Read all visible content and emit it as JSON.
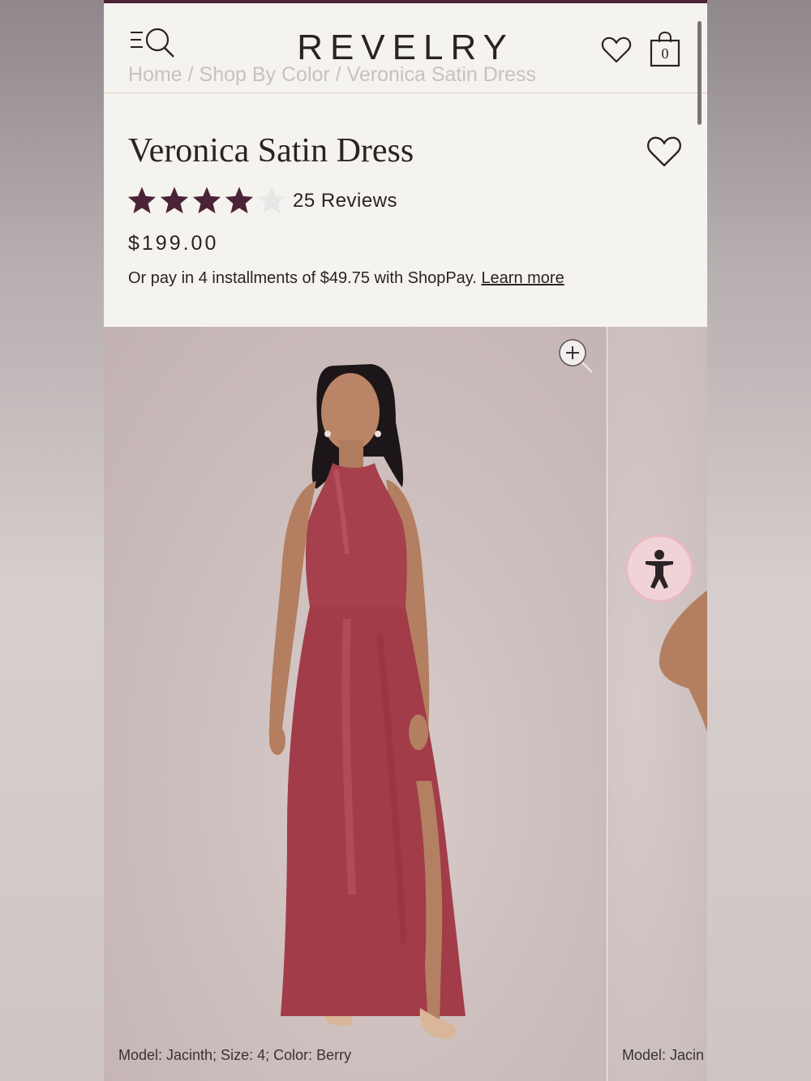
{
  "header": {
    "logo": "REVELRY",
    "menu_icon": "menu-search-icon",
    "wishlist_icon": "heart-icon",
    "bag_icon": "shopping-bag-icon",
    "bag_count": "0"
  },
  "breadcrumb": {
    "items": [
      "Home",
      "Shop By Color",
      "Veronica Satin Dress"
    ],
    "separator": " / "
  },
  "product": {
    "title": "Veronica Satin Dress",
    "rating_stars": 4,
    "rating_max": 5,
    "reviews_label": "25 Reviews",
    "price": "$199.00",
    "installments_text": "Or pay in 4 installments of $49.75 with ShopPay.",
    "learn_more_label": "Learn more"
  },
  "gallery": {
    "slides": [
      {
        "caption": "Model: Jacinth; Size: 4; Color: Berry"
      },
      {
        "caption": "Model: Jacin"
      }
    ],
    "zoom_icon": "zoom-in-icon",
    "accessibility_icon": "accessibility-icon"
  },
  "colors": {
    "accent_dark": "#4b2336",
    "star_filled": "#4b2336",
    "star_empty": "#e8e6e6",
    "dress": "#a8404c",
    "background": "#f5f3ef"
  }
}
